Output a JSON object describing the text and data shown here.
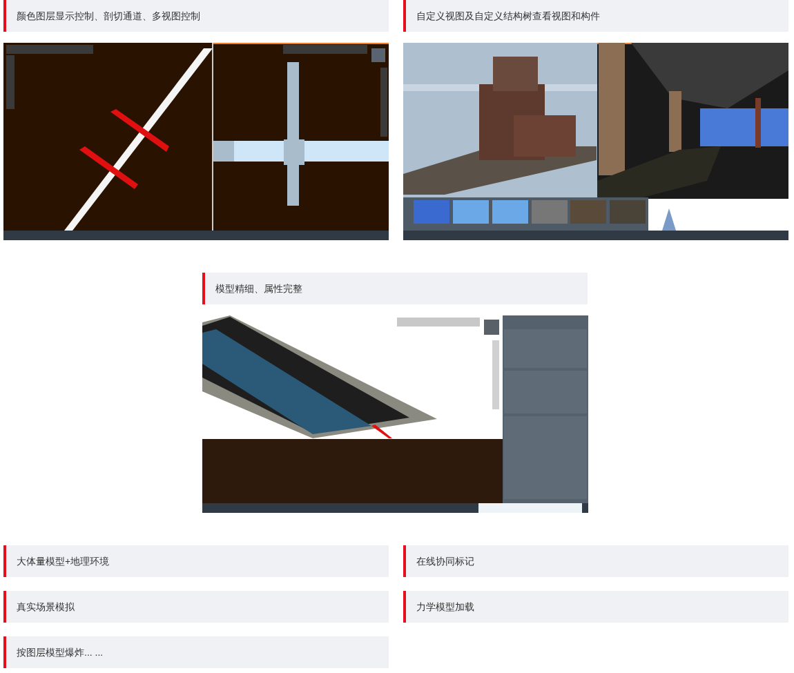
{
  "showcase": [
    {
      "title": "颜色图层显示控制、剖切通道、多视图控制",
      "kind": "dual_view_cad"
    },
    {
      "title": "自定义视图及自定义结构树查看视图和构件",
      "kind": "building_3d"
    },
    {
      "title": "模型精细、属性完整",
      "kind": "road_properties"
    }
  ],
  "features": [
    {
      "title": "大体量模型+地理环境"
    },
    {
      "title": "在线协同标记"
    },
    {
      "title": "真实场景模拟"
    },
    {
      "title": "力学模型加载"
    },
    {
      "title": "按图层模型爆炸... ..."
    }
  ]
}
